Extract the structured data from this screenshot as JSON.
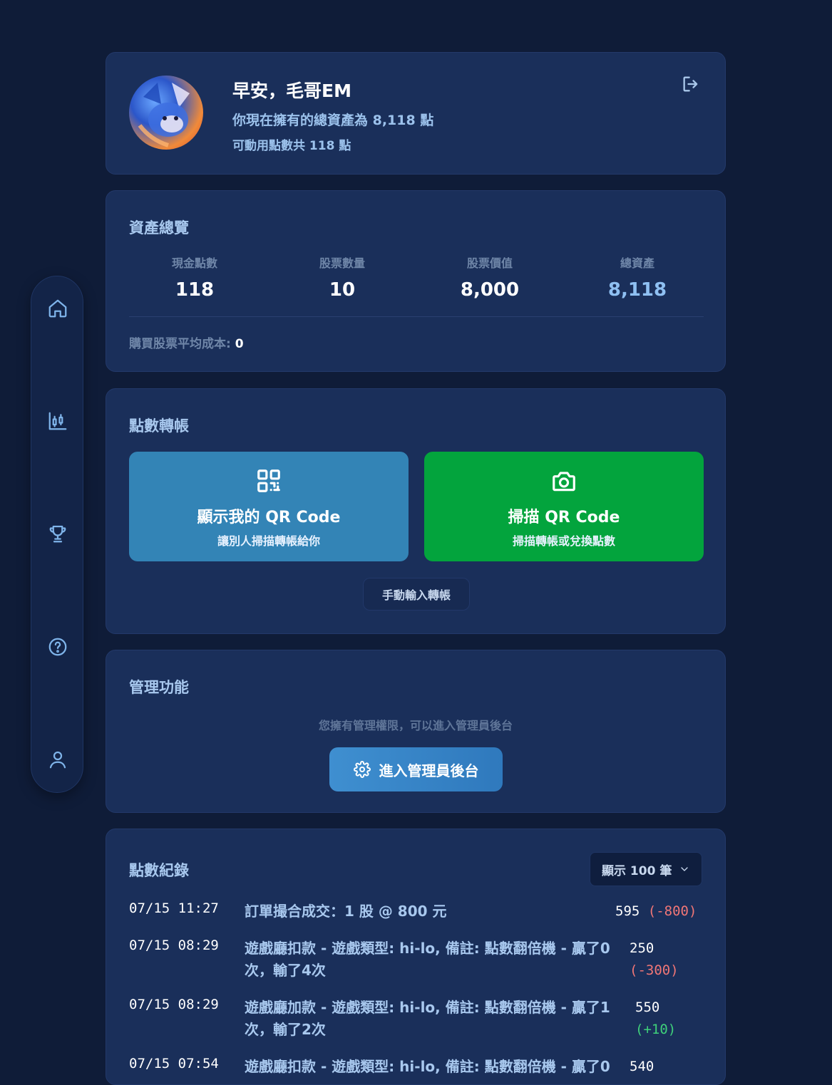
{
  "sidebar": {
    "items": [
      {
        "icon": "home-icon"
      },
      {
        "icon": "chart-icon"
      },
      {
        "icon": "trophy-icon"
      },
      {
        "icon": "help-icon"
      },
      {
        "icon": "user-icon"
      }
    ]
  },
  "profile": {
    "greeting": "早安，毛哥EM",
    "total_assets_line": "你現在擁有的總資產為 8,118 點",
    "available_points_line": "可動用點數共 118 點",
    "logout_icon": "logout-icon"
  },
  "overview": {
    "title": "資產總覽",
    "stats": [
      {
        "label": "現金點數",
        "value": "118"
      },
      {
        "label": "股票數量",
        "value": "10"
      },
      {
        "label": "股票價值",
        "value": "8,000"
      },
      {
        "label": "總資產",
        "value": "8,118"
      }
    ],
    "avg_cost_label": "購買股票平均成本:",
    "avg_cost_value": "0"
  },
  "transfer": {
    "title": "點數轉帳",
    "show_qr": {
      "title": "顯示我的 QR Code",
      "subtitle": "讓別人掃描轉帳給你",
      "color": "#3384b6"
    },
    "scan_qr": {
      "title": "掃描 QR Code",
      "subtitle": "掃描轉帳或兌換點數",
      "color": "#03a43d"
    },
    "manual_label": "手動輸入轉帳"
  },
  "admin": {
    "title": "管理功能",
    "note": "您擁有管理權限，可以進入管理員後台",
    "button_label": "進入管理員後台"
  },
  "records": {
    "title": "點數紀錄",
    "show_count_label": "顯示 100 筆",
    "items": [
      {
        "time": "07/15 11:27",
        "desc": "訂單撮合成交：1 股 @ 800 元",
        "balance": "595",
        "change": "(-800)",
        "sign": "neg"
      },
      {
        "time": "07/15 08:29",
        "desc": "遊戲廳扣款 - 遊戲類型: hi-lo, 備註: 點數翻倍機 - 贏了0次，輸了4次",
        "balance": "250",
        "change": "(-300)",
        "sign": "neg"
      },
      {
        "time": "07/15 08:29",
        "desc": "遊戲廳加款 - 遊戲類型: hi-lo, 備註: 點數翻倍機 - 贏了1次，輸了2次",
        "balance": "550",
        "change": "(+10)",
        "sign": "pos"
      },
      {
        "time": "07/15 07:54",
        "desc": "遊戲廳扣款 - 遊戲類型: hi-lo, 備註: 點數翻倍機 - 贏了0",
        "balance": "540",
        "change": "",
        "sign": "neg"
      }
    ]
  }
}
